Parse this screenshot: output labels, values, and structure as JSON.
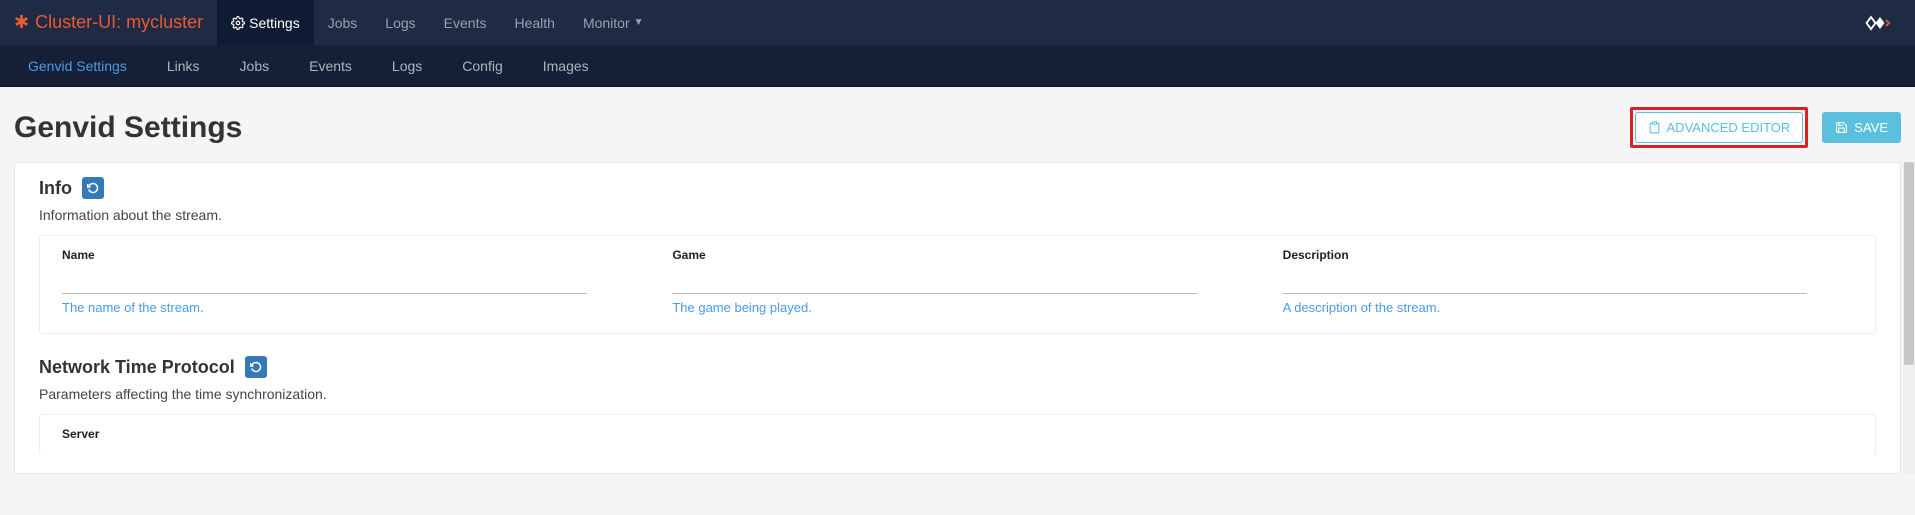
{
  "brand": {
    "text": "Cluster-UI: mycluster"
  },
  "topnav": {
    "settings": "Settings",
    "jobs": "Jobs",
    "logs": "Logs",
    "events": "Events",
    "health": "Health",
    "monitor": "Monitor"
  },
  "subnav": {
    "genvid_settings": "Genvid Settings",
    "links": "Links",
    "jobs": "Jobs",
    "events": "Events",
    "logs": "Logs",
    "config": "Config",
    "images": "Images"
  },
  "page": {
    "title": "Genvid Settings",
    "advanced_editor": "ADVANCED EDITOR",
    "save": "SAVE"
  },
  "sections": {
    "info": {
      "title": "Info",
      "desc": "Information about the stream.",
      "fields": {
        "name": {
          "label": "Name",
          "value": "",
          "help": "The name of the stream."
        },
        "game": {
          "label": "Game",
          "value": "",
          "help": "The game being played."
        },
        "description": {
          "label": "Description",
          "value": "",
          "help": "A description of the stream."
        }
      }
    },
    "ntp": {
      "title": "Network Time Protocol",
      "desc": "Parameters affecting the time synchronization.",
      "fields": {
        "server": {
          "label": "Server"
        }
      }
    }
  }
}
